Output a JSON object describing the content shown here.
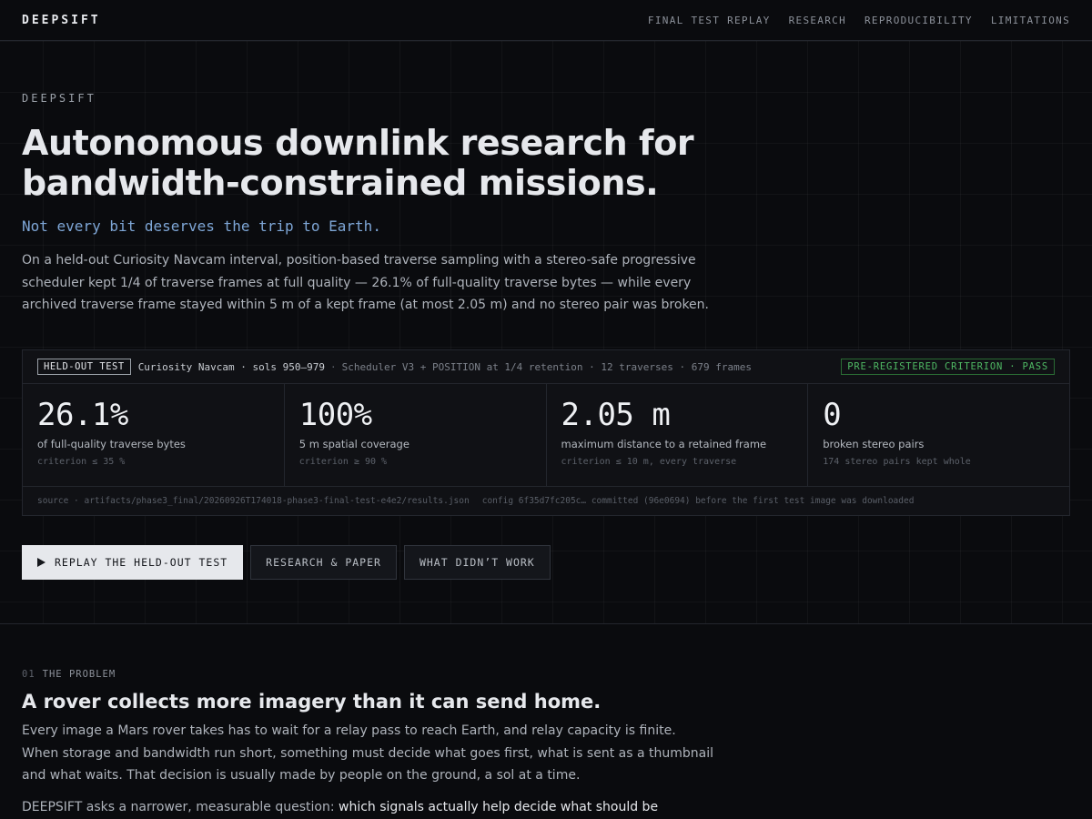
{
  "nav": {
    "brand": "DEEPSIFT",
    "links": [
      "FINAL TEST REPLAY",
      "RESEARCH",
      "REPRODUCIBILITY",
      "LIMITATIONS"
    ]
  },
  "hero": {
    "eyebrow": "DEEPSIFT",
    "title_line1": "Autonomous downlink research for",
    "title_line2": "bandwidth-constrained missions.",
    "tagline": "Not every bit deserves the trip to Earth.",
    "lede": "On a held-out Curiosity Navcam interval, position-based traverse sampling with a stereo-safe progressive scheduler kept 1/4 of traverse frames at full quality — 26.1% of full-quality traverse bytes — while every archived traverse frame stayed within 5 m of a kept frame (at most 2.05 m) and no stereo pair was broken."
  },
  "results": {
    "badge": "HELD-OUT TEST",
    "dataset": "Curiosity Navcam · sols 950–979",
    "sep": "·",
    "details": "Scheduler V3 + POSITION at 1/4 retention · 12 traverses · 679 frames",
    "status": "PRE-REGISTERED CRITERION · PASS",
    "status_color": "#4fb964",
    "metrics": [
      {
        "value": "26.1%",
        "label": "of full-quality traverse bytes",
        "criterion": "criterion ≤ 35 %"
      },
      {
        "value": "100%",
        "label": "5 m spatial coverage",
        "criterion": "criterion ≥ 90 %"
      },
      {
        "value": "2.05 m",
        "label": "maximum distance to a retained frame",
        "criterion": "criterion ≤ 10 m, every traverse"
      },
      {
        "value": "0",
        "label": "broken stereo pairs",
        "criterion": "174 stereo pairs kept whole"
      }
    ],
    "source": "source · artifacts/phase3_final/20260926T174018-phase3-final-test-e4e2/results.json",
    "config": "config 6f35d7fc205c… committed (96e0694) before the first test image was downloaded"
  },
  "buttons": {
    "replay": "REPLAY THE HELD-OUT TEST",
    "replay_icon": "play-icon",
    "research": "RESEARCH & PAPER",
    "didnt_work": "WHAT DIDN’T WORK"
  },
  "problem": {
    "number": "01",
    "eyebrow": "THE PROBLEM",
    "title": "A rover collects more imagery than it can send home.",
    "paragraph": "Every image a Mars rover takes has to wait for a relay pass to reach Earth, and relay capacity is finite. When storage and bandwidth run short, something must decide what goes first, what is sent as a thumbnail and what waits. That decision is usually made by people on the ground, a sol at a time.",
    "question_lead": "DEEPSIFT asks a narrower, measurable question: ",
    "question_highlight": "which signals actually help decide what should be"
  }
}
